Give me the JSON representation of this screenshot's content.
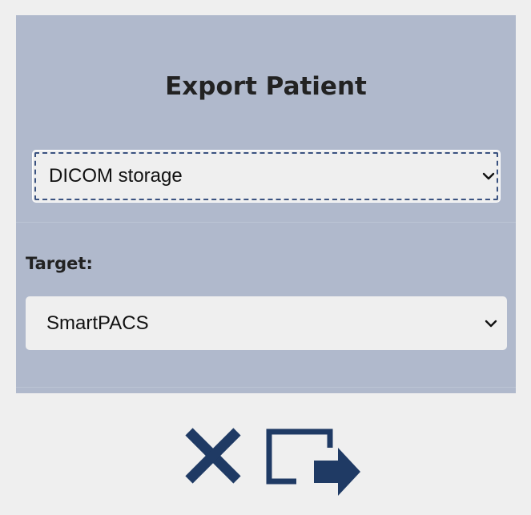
{
  "dialog": {
    "title": "Export Patient"
  },
  "format_select": {
    "value": "DICOM storage",
    "icon": "chevron-down-icon"
  },
  "target": {
    "label": "Target:",
    "value": "SmartPACS",
    "icon": "chevron-down-icon"
  },
  "actions": {
    "cancel_icon": "close-icon",
    "export_icon": "export-icon"
  },
  "colors": {
    "panel_bg": "#b0b9cc",
    "page_bg": "#efefef",
    "accent": "#1f3a64",
    "focus_outline": "#3a5280"
  }
}
